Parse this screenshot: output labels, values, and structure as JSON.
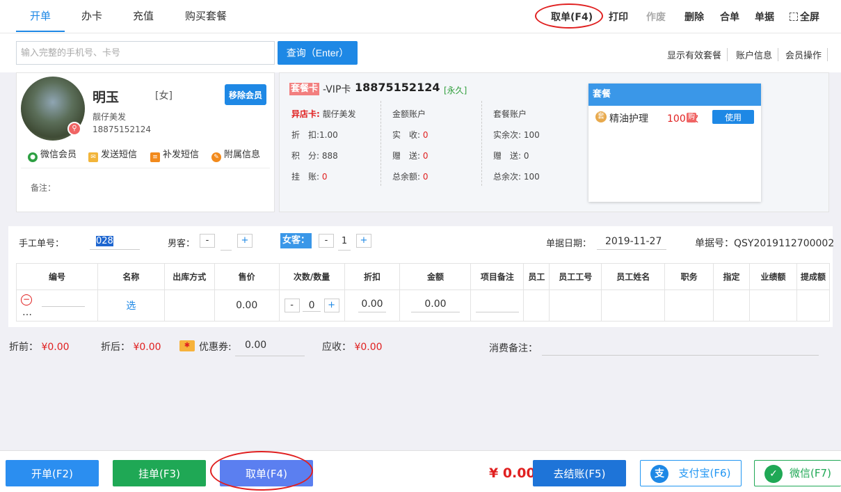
{
  "tabs": [
    "开单",
    "办卡",
    "充值",
    "购买套餐"
  ],
  "top_actions": {
    "take": "取单(F4)",
    "print": "打印",
    "void": "作废",
    "delete": "删除",
    "merge": "合单",
    "receipt": "单据",
    "fullscreen": "全屏"
  },
  "search": {
    "placeholder": "输入完整的手机号、卡号",
    "button": "查询（Enter）"
  },
  "search_links": [
    "显示有效套餐",
    "账户信息",
    "会员操作"
  ],
  "member": {
    "name": "明玉",
    "gender": "[女]",
    "remove_button": "移除会员",
    "store": "靓仔美发",
    "phone": "18875152124",
    "actions": [
      "微信会员",
      "发送短信",
      "补发短信",
      "附属信息"
    ],
    "remark_label": "备注："
  },
  "card": {
    "type": "套餐卡",
    "vip": "-VIP卡",
    "number": "18875152124",
    "validity": "[永久]",
    "other_store_label": "异店卡:",
    "other_store": "靓仔美发",
    "discount_label": "折　扣:",
    "discount": "1.00",
    "points_label": "积　分:",
    "points": "888",
    "credit_label": "挂　账:",
    "credit": "0",
    "amount_account": "金额账户",
    "received_label": "实　收:",
    "received": "0",
    "gift_label": "赠　送:",
    "gift": "0",
    "balance_label": "总余额:",
    "balance": "0",
    "package_account": "套餐账户",
    "actual_remain_label": "实余次:",
    "actual_remain": "100",
    "gift_times_label": "赠　送:",
    "gift_times": "0",
    "total_remain_label": "总余次:",
    "total_remain": "100"
  },
  "package": {
    "header": "套餐",
    "icon_char": "套",
    "name": "精油护理",
    "count": "100 次",
    "buy_char": "购",
    "use_button": "使用"
  },
  "order": {
    "manual_no_label": "手工单号：",
    "manual_no": "028",
    "male_label": "男客：",
    "male_count": "",
    "female_label": "女客：",
    "female_count": "1",
    "minus": "-",
    "plus": "+",
    "date_label": "单据日期：",
    "date": "2019-11-27",
    "receipt_no": "单据号：QSY2019112700002"
  },
  "table": {
    "headers": [
      "编号",
      "名称",
      "出库方式",
      "售价",
      "次数/数量",
      "折扣",
      "金额",
      "项目备注",
      "员工",
      "员工工号",
      "员工姓名",
      "职务",
      "指定",
      "业绩额",
      "提成额"
    ],
    "row": {
      "more": "…",
      "select": "选",
      "price": "0.00",
      "qty": "0",
      "discount": "0.00",
      "amount": "0.00"
    }
  },
  "totals": {
    "before_label": "折前：",
    "before": "¥0.00",
    "after_label": "折后：",
    "after": "¥0.00",
    "coupon_label": "优惠券:",
    "coupon": "0.00",
    "receivable_label": "应收：",
    "receivable": "¥0.00",
    "remark_label": "消费备注："
  },
  "bottom": {
    "open": "开单(F2)",
    "hold": "挂单(F3)",
    "take": "取单(F4)",
    "total": "¥ 0.00",
    "checkout": "去结账(F5)",
    "alipay": "支付宝(F6)",
    "alipay_icon": "支",
    "wechat": "微信(F7)"
  },
  "colors": {
    "primary": "#1e88e5",
    "danger": "#e02020",
    "green": "#1fa855",
    "violet": "#5b7ff0"
  }
}
